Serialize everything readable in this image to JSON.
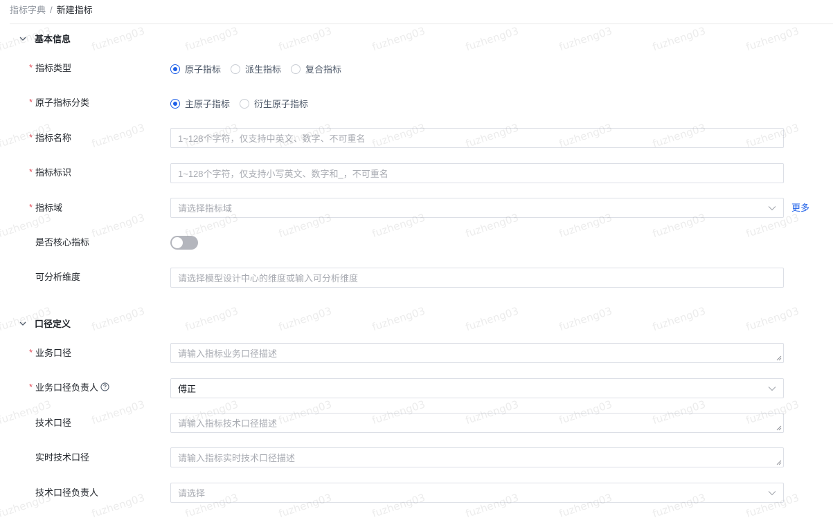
{
  "breadcrumb": {
    "parent": "指标字典",
    "separator": "/",
    "current": "新建指标"
  },
  "watermark": "fuzheng03",
  "sections": {
    "basic": {
      "title": "基本信息"
    },
    "caliber": {
      "title": "口径定义"
    }
  },
  "form": {
    "metric_type": {
      "label": "指标类型",
      "required": true,
      "options": [
        "原子指标",
        "派生指标",
        "复合指标"
      ],
      "selected": "原子指标"
    },
    "atomic_category": {
      "label": "原子指标分类",
      "required": true,
      "options": [
        "主原子指标",
        "衍生原子指标"
      ],
      "selected": "主原子指标"
    },
    "metric_name": {
      "label": "指标名称",
      "required": true,
      "placeholder": "1~128个字符，仅支持中英文、数字、不可重名",
      "value": ""
    },
    "metric_id": {
      "label": "指标标识",
      "required": true,
      "placeholder": "1~128个字符，仅支持小写英文、数字和_，不可重名",
      "value": ""
    },
    "metric_domain": {
      "label": "指标域",
      "required": true,
      "placeholder": "请选择指标域",
      "more_label": "更多"
    },
    "is_core": {
      "label": "是否核心指标",
      "required": false,
      "on": false
    },
    "dimensions": {
      "label": "可分析维度",
      "required": false,
      "placeholder": "请选择模型设计中心的维度或输入可分析维度"
    },
    "business_caliber": {
      "label": "业务口径",
      "required": true,
      "placeholder": "请输入指标业务口径描述"
    },
    "business_owner": {
      "label": "业务口径负责人",
      "required": true,
      "value": "傅正"
    },
    "tech_caliber": {
      "label": "技术口径",
      "required": false,
      "placeholder": "请输入指标技术口径描述"
    },
    "realtime_tech_caliber": {
      "label": "实时技术口径",
      "required": false,
      "placeholder": "请输入指标实时技术口径描述"
    },
    "tech_owner": {
      "label": "技术口径负责人",
      "required": false,
      "placeholder": "请选择"
    }
  },
  "colors": {
    "accent": "#1e60e8",
    "required": "#e34d59",
    "toggle_off": "#b4b6bd"
  },
  "icons": {
    "collapse": "chevron-down-icon",
    "help": "help-circle-icon",
    "select_arrow": "chevron-down-icon"
  }
}
